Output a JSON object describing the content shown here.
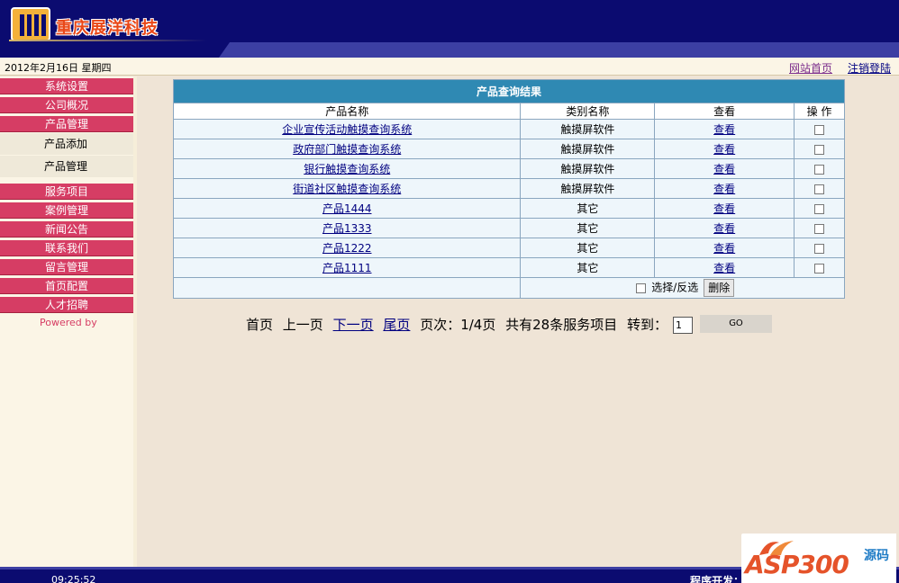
{
  "header": {
    "company_name": "重庆展洋科技"
  },
  "infobar": {
    "date": "2012年2月16日  星期四",
    "home_link": "网站首页",
    "logout_link": "注销登陆"
  },
  "sidebar": {
    "items": [
      "系统设置",
      "公司概况",
      "产品管理"
    ],
    "subitems": [
      "产品添加",
      "产品管理"
    ],
    "items2": [
      "服务项目",
      "案例管理",
      "新闻公告",
      "联系我们",
      "留言管理",
      "首页配置",
      "人才招聘"
    ],
    "powered_by": "Powered by"
  },
  "table": {
    "title": "产品查询结果",
    "headers": [
      "产品名称",
      "类别名称",
      "查看",
      "操 作"
    ],
    "rows": [
      {
        "name": "企业宣传活动触摸查询系统",
        "category": "触摸屏软件",
        "view": "查看"
      },
      {
        "name": "政府部门触摸查询系统",
        "category": "触摸屏软件",
        "view": "查看"
      },
      {
        "name": "银行触摸查询系统",
        "category": "触摸屏软件",
        "view": "查看"
      },
      {
        "name": "街道社区触摸查询系统",
        "category": "触摸屏软件",
        "view": "查看"
      },
      {
        "name": "产品1444",
        "category": "其它",
        "view": "查看"
      },
      {
        "name": "产品1333",
        "category": "其它",
        "view": "查看"
      },
      {
        "name": "产品1222",
        "category": "其它",
        "view": "查看"
      },
      {
        "name": "产品1111",
        "category": "其它",
        "view": "查看"
      }
    ],
    "select_label": "选择/反选",
    "delete_label": "删除"
  },
  "pager": {
    "first": "首页",
    "prev": "上一页",
    "next": "下一页",
    "last": "尾页",
    "info": "页次：1/4页",
    "total": "共有28条服务项目",
    "goto_label": "转到：",
    "page_value": "1",
    "go_label": "GO"
  },
  "footer": {
    "time": "09:25:52",
    "dev_text": "程序开发："
  },
  "watermark": {
    "main": "ASP300",
    "side": "源码"
  }
}
